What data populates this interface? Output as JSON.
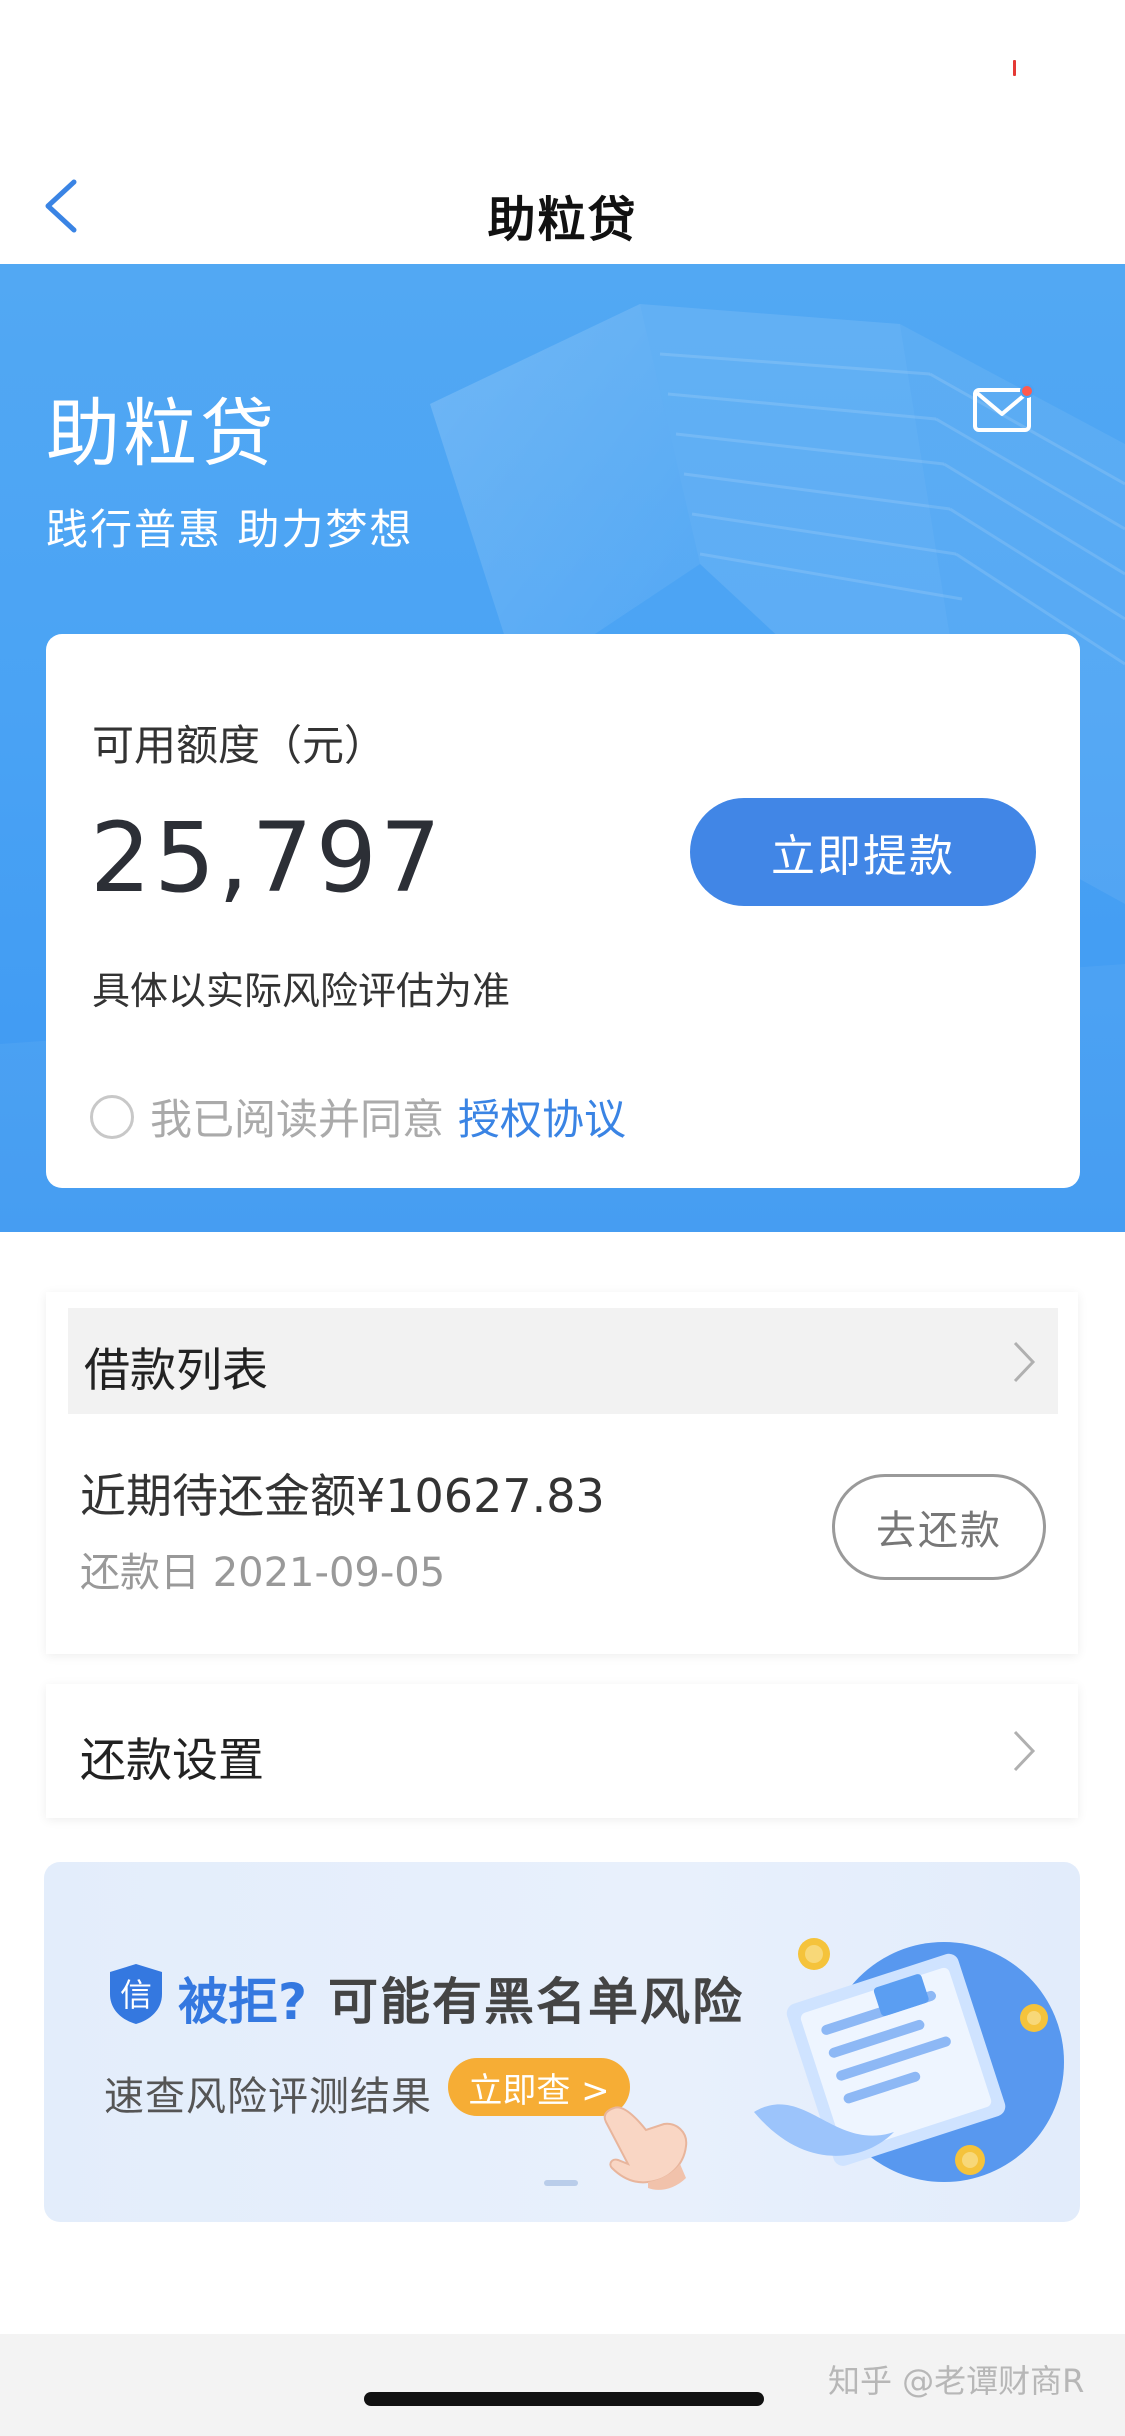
{
  "nav": {
    "title": "助粒贷",
    "back_icon": "chevron-left-icon"
  },
  "hero": {
    "title": "助粒贷",
    "subtitle": "践行普惠 助力梦想",
    "mail_icon": "mail-icon",
    "has_notification": true
  },
  "limit_card": {
    "label": "可用额度（元）",
    "amount": "25,797",
    "withdraw_button": "立即提款",
    "note": "具体以实际风险评估为准",
    "agree_text": "我已阅读并同意",
    "agree_link": "授权协议",
    "agreed": false
  },
  "loan_list": {
    "header": "借款列表",
    "due_amount": "近期待还金额¥10627.83",
    "due_date": "还款日 2021-09-05",
    "repay_button": "去还款"
  },
  "repayment_settings": {
    "label": "还款设置"
  },
  "banner": {
    "shield_char": "信",
    "rejected": "被拒?",
    "headline": "可能有黑名单风险",
    "sub": "速查风险评测结果",
    "cta": "立即查 >"
  },
  "footer": {
    "watermark": "知乎 @老谭财商R"
  },
  "colors": {
    "primary": "#4186e6",
    "hero": "#4aa3f4",
    "link": "#3a84e4",
    "cta_orange": "#f6ad35",
    "notification": "#ff5a4e"
  }
}
